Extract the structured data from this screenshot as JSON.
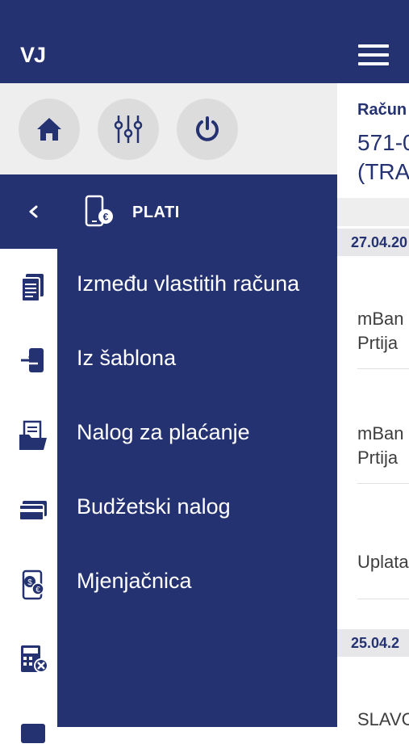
{
  "header": {
    "initials": "VJ",
    "menu_icon": "hamburger-icon"
  },
  "quick_actions": [
    {
      "icon": "home-icon"
    },
    {
      "icon": "sliders-icon"
    },
    {
      "icon": "power-icon"
    }
  ],
  "drawer": {
    "back_icon": "chevron-left-icon",
    "section_icon": "phone-euro-icon",
    "title": "PLATI",
    "items": [
      {
        "label": "Između vlastitih računa",
        "icon": "document-icon"
      },
      {
        "label": "Iz šablona",
        "icon": "phone-transfer-icon"
      },
      {
        "label": "Nalog za plaćanje",
        "icon": "folder-document-icon"
      },
      {
        "label": "Budžetski nalog",
        "icon": "card-icon"
      },
      {
        "label": "Mjenjačnica",
        "icon": "currency-exchange-icon"
      },
      {
        "label": "",
        "icon": "calculator-icon"
      },
      {
        "label": "",
        "icon": "wallet-icon"
      }
    ]
  },
  "background": {
    "account_label": "Račun",
    "account_number": "571-0",
    "account_type": "(TRA",
    "groups": [
      {
        "date": "27.04.20",
        "transactions": [
          {
            "line1": "mBan",
            "line2": "Prtija"
          },
          {
            "line1": "mBan",
            "line2": "Prtija"
          },
          {
            "line1": "Uplata",
            "line2": ""
          }
        ]
      },
      {
        "date": "25.04.2",
        "transactions": [
          {
            "line1": "SLAVC",
            "line2": ""
          }
        ]
      }
    ]
  },
  "colors": {
    "primary": "#243272",
    "panel_bg": "#eeeeee",
    "button_bg": "#dcdcdc",
    "text_on_primary": "#ffffff"
  }
}
